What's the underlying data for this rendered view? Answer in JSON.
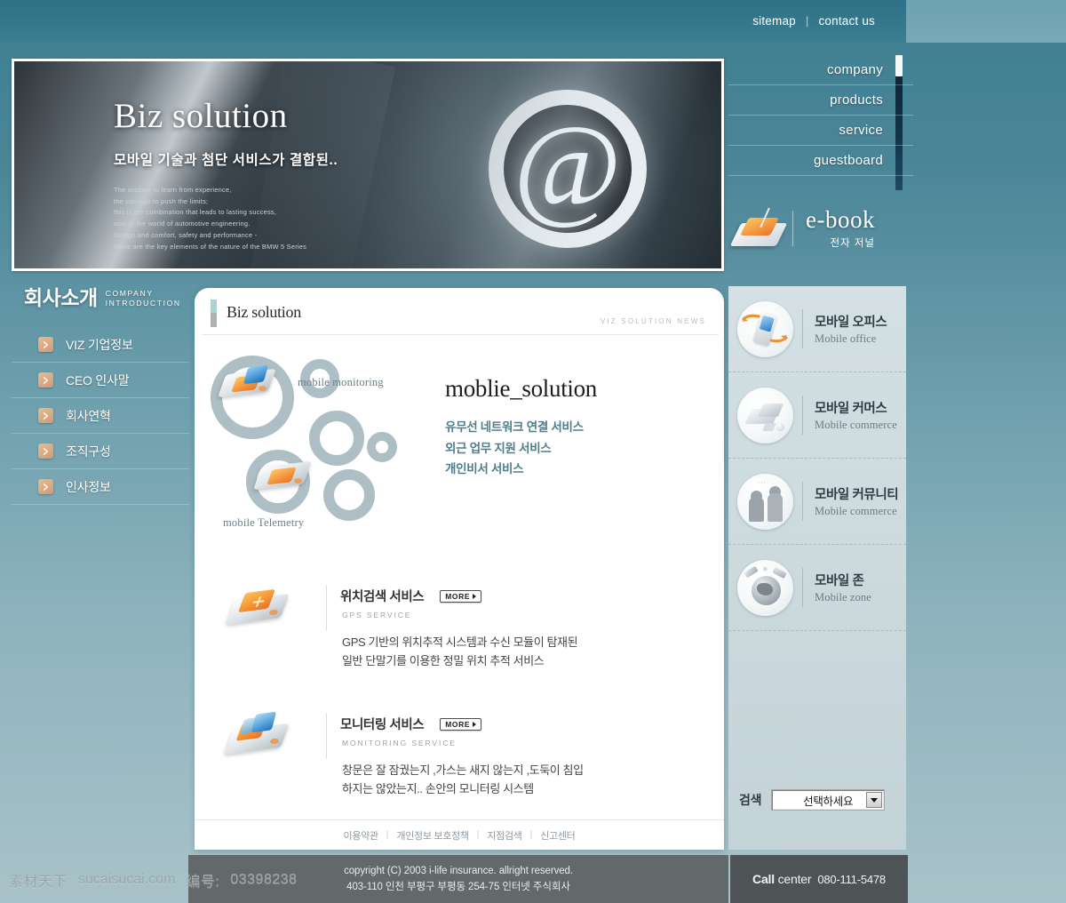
{
  "topbar": {
    "sitemap": "sitemap",
    "separator": "|",
    "contact": "contact us"
  },
  "hero": {
    "title": "Biz solution",
    "subtitle": "모바일 기술과 첨단 서비스가 결합된..",
    "paragraph": [
      "The wisdom to learn from experience,",
      "the courage to push the limits;",
      "this is the combination that leads to lasting success,",
      "also in the world of automotive engineering.",
      "Design and comfort, safety and performance -",
      "these are the key elements of the nature of the BMW 5 Series"
    ],
    "at_symbol": "@"
  },
  "topnav": {
    "items": [
      {
        "label": "company"
      },
      {
        "label": "products"
      },
      {
        "label": "service"
      },
      {
        "label": "guestboard"
      }
    ]
  },
  "ebook": {
    "en": "e-book",
    "kr": "전자 저널"
  },
  "leftcol": {
    "heading_kr": "회사소개",
    "heading_en_line1": "COMPANY",
    "heading_en_line2": "INTRODUCTION",
    "items": [
      {
        "label": "VIZ 기업정보"
      },
      {
        "label": "CEO 인사말"
      },
      {
        "label": "회사연혁"
      },
      {
        "label": "조직구성"
      },
      {
        "label": "인사정보"
      }
    ]
  },
  "card": {
    "title": "Biz solution",
    "eyebrow": "VIZ SOLUTION NEWS",
    "solution": {
      "bubble_label_top": "mobile monitoring",
      "bubble_label_bottom": "mobile Telemetry",
      "title": "moblie_solution",
      "lines": [
        "유무선 네트워크 연결 서비스",
        "외근 업무 지원 서비스",
        "개인비서 서비스"
      ]
    },
    "services": [
      {
        "name": "위치검색 서비스",
        "en": "GPS SERVICE",
        "more": "MORE",
        "desc_line1": "GPS 기반의 위치추적 시스템과 수신 모듈이 탐재된",
        "desc_line2": "일반 단말기를 이용한 정밀 위치 추적 서비스"
      },
      {
        "name": "모니터링 서비스",
        "en": "MONITORING SERVICE",
        "more": "MORE",
        "desc_line1": "창문은 잘 잠궜는지 ,가스는 새지 않는지 ,도둑이 침입",
        "desc_line2": "하지는 않았는지.. 손안의 모니터링 시스템"
      }
    ],
    "footer_links": [
      "이용약관",
      "개인정보 보호정책",
      "지점검색",
      "신고센터"
    ],
    "footer_sep": "|"
  },
  "rpanel": {
    "items": [
      {
        "kr": "모바일 오피스",
        "en": "Mobile office"
      },
      {
        "kr": "모바일 커머스",
        "en": "Mobile commerce"
      },
      {
        "kr": "모바일 커뮤니티",
        "en": "Mobile commerce"
      },
      {
        "kr": "모바일 존",
        "en": "Mobile zone"
      }
    ],
    "search": {
      "label": "검색",
      "selected": "선택하세요"
    }
  },
  "footer": {
    "copyright_line1": "copyright (C) 2003 i-life insurance. allright reserved.",
    "copyright_line2": "403-110 인천 부평구 부평동 254-75 인터넷 주식회사",
    "call_label_bold": "Call",
    "call_label_rest": " center",
    "call_number": "080-111-5478"
  },
  "watermark": {
    "site_kr": "素材天下",
    "site": "sucaisucai.com",
    "code_label": "编号:",
    "code": "03398238"
  },
  "colors": {
    "page_top": "#3d7f92",
    "page_bottom": "#a9c2c9",
    "accent_orange": "#cf9b74",
    "link_blue": "#4f7d8a",
    "bubble_gray": "#adbfc4",
    "footer_gray": "#63686b",
    "call_gray": "#4e5356"
  }
}
